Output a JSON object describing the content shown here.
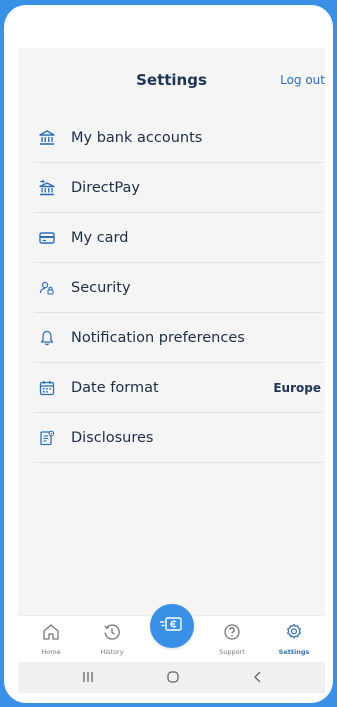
{
  "header": {
    "title": "Settings",
    "logout_label": "Log out"
  },
  "settings": {
    "items": [
      {
        "label": "My bank accounts",
        "icon": "bank-icon",
        "value": ""
      },
      {
        "label": "DirectPay",
        "icon": "bank-transfer-icon",
        "value": ""
      },
      {
        "label": "My card",
        "icon": "card-icon",
        "value": ""
      },
      {
        "label": "Security",
        "icon": "user-lock-icon",
        "value": ""
      },
      {
        "label": "Notification preferences",
        "icon": "bell-icon",
        "value": ""
      },
      {
        "label": "Date format",
        "icon": "calendar-icon",
        "value": "Europe"
      },
      {
        "label": "Disclosures",
        "icon": "document-icon",
        "value": ""
      }
    ]
  },
  "tabbar": {
    "home": "Home",
    "history": "History",
    "support": "Support",
    "settings": "Settings",
    "active": "settings"
  },
  "colors": {
    "brand": "#3a8fe6",
    "accent": "#2f6fb5",
    "text": "#1e2e45",
    "screen_bg": "#f5f5f5"
  }
}
